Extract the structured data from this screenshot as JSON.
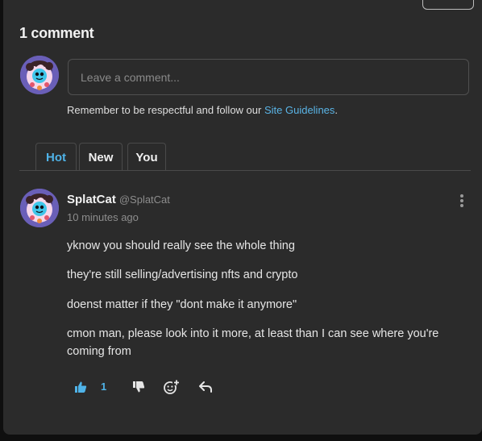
{
  "comments_header": {
    "count_label": "1 comment"
  },
  "compose": {
    "placeholder": "Leave a comment...",
    "guidelines_text": "Remember to be respectful and follow our ",
    "guidelines_link": "Site Guidelines",
    "guidelines_suffix": "."
  },
  "sort_tabs": [
    {
      "label": "Hot",
      "active": true
    },
    {
      "label": "New",
      "active": false
    },
    {
      "label": "You",
      "active": false
    }
  ],
  "comment": {
    "author": "SplatCat",
    "handle": "@SplatCat",
    "time": "10 minutes ago",
    "paragraphs": [
      "yknow you should really see the whole thing",
      "they're still selling/advertising nfts and crypto",
      "doenst matter if they \"dont make it anymore\"",
      "cmon man, please look into it more, at least than I can see where you're coming from"
    ],
    "upvotes": "1"
  },
  "colors": {
    "accent": "#4fb3e8",
    "panel": "#2b2b2b",
    "background": "#0f0f0f"
  },
  "icons": [
    "thumbs-up-icon",
    "thumbs-down-icon",
    "add-reaction-icon",
    "reply-icon",
    "more-options-icon"
  ]
}
